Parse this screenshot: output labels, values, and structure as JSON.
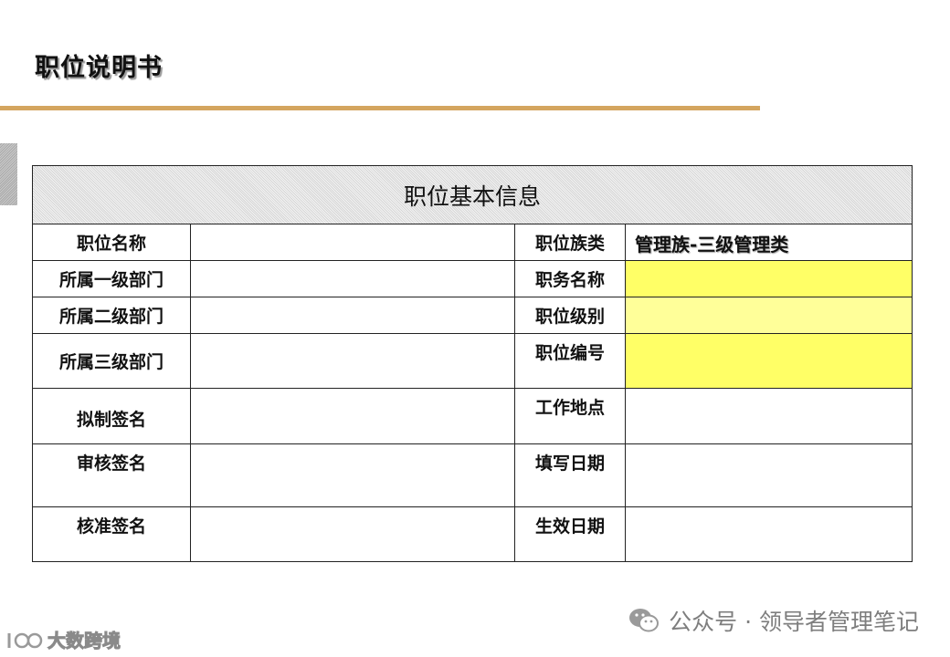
{
  "page": {
    "title": "职位说明书"
  },
  "table": {
    "header": "职位基本信息",
    "rows": [
      {
        "left_label": "职位名称",
        "left_value": "",
        "right_label": "职位族类",
        "right_value": "管理族-三级管理类"
      },
      {
        "left_label": "所属一级部门",
        "left_value": "",
        "right_label": "职务名称",
        "right_value": ""
      },
      {
        "left_label": "所属二级部门",
        "left_value": "",
        "right_label": "职位级别",
        "right_value": ""
      },
      {
        "left_label": "所属三级部门",
        "left_value": "",
        "right_label": "职位编号",
        "right_value": ""
      },
      {
        "left_label": "拟制签名",
        "left_value": "",
        "right_label": "工作地点",
        "right_value": ""
      },
      {
        "left_label": "审核签名",
        "left_value": "",
        "right_label": "填写日期",
        "right_value": ""
      },
      {
        "left_label": "核准签名",
        "left_value": "",
        "right_label": "生效日期",
        "right_value": ""
      }
    ]
  },
  "colors": {
    "title_rule": "#d4a55f",
    "highlight_yellow": "#ffff66",
    "highlight_yellow_light": "#ffff99"
  },
  "watermark": {
    "text": "公众号 · 领导者管理笔记",
    "icon": "wechat-icon"
  },
  "brand": {
    "text": "大数跨境",
    "icon": "brand-logo-icon"
  }
}
